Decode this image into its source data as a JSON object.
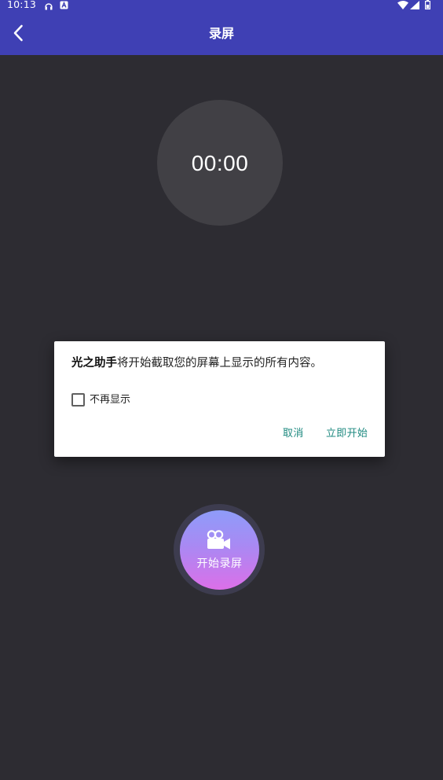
{
  "status_bar": {
    "time": "10:13",
    "icons": [
      "headset-icon",
      "a-badge-icon",
      "wifi-icon",
      "signal-icon",
      "battery-icon"
    ]
  },
  "app_bar": {
    "title": "录屏",
    "back_icon": "chevron-left-icon"
  },
  "timer": {
    "value": "00:00"
  },
  "record_button": {
    "label": "开始录屏",
    "icon": "video-camera-icon"
  },
  "dialog": {
    "app_name": "光之助手",
    "message": "将开始截取您的屏幕上显示的所有内容。",
    "checkbox_label": "不再显示",
    "checkbox_checked": false,
    "cancel_label": "取消",
    "confirm_label": "立即开始"
  },
  "colors": {
    "app_bar": "#3f40b4",
    "background": "#2d2c32",
    "timer_circle": "#414045",
    "dialog_button_text": "#1f8a80",
    "record_gradient_top": "#8e9cf9",
    "record_gradient_bottom": "#dc6fe8"
  }
}
